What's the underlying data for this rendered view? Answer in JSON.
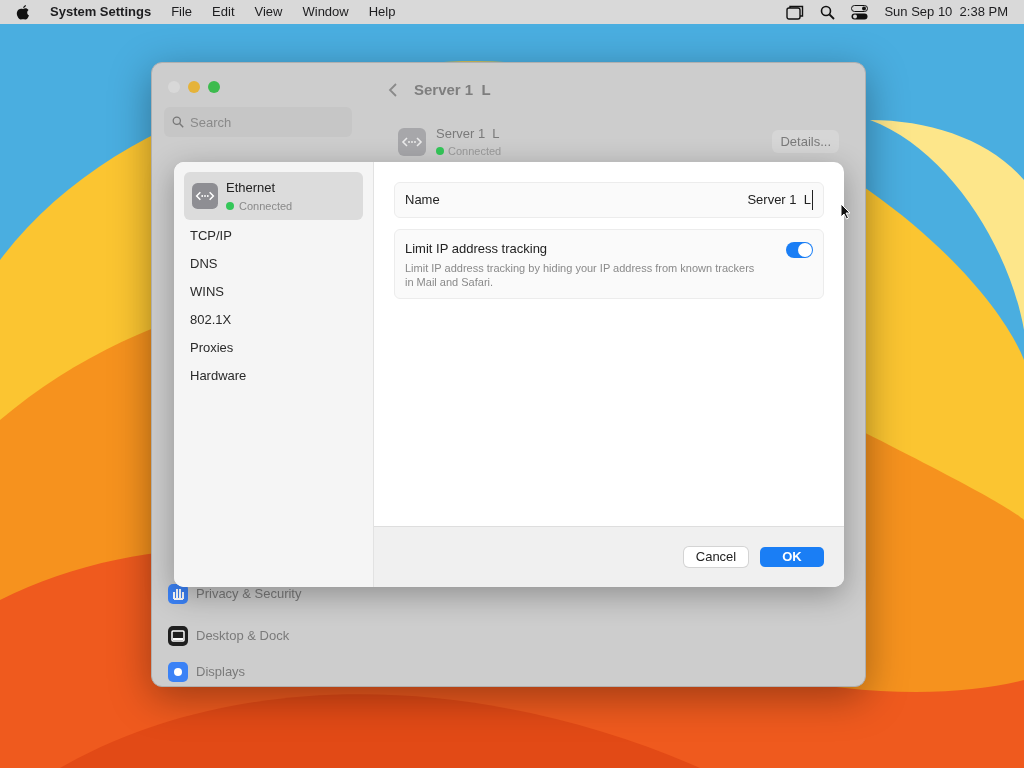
{
  "menu_bar": {
    "app": "System Settings",
    "menus": [
      "File",
      "Edit",
      "View",
      "Window",
      "Help"
    ],
    "clock": "Sun Sep 10  2:38 PM"
  },
  "window": {
    "title": "Server 1  L",
    "search": {
      "placeholder": "Search"
    },
    "service": {
      "name": "Server 1  L",
      "status": "Connected",
      "details_button": "Details..."
    },
    "sidebar_items": [
      {
        "label": "Privacy & Security",
        "kind": "privacy"
      },
      {
        "label": "Desktop & Dock",
        "kind": "desktop"
      },
      {
        "label": "Displays",
        "kind": "displays"
      }
    ]
  },
  "sheet": {
    "header": {
      "name": "Ethernet",
      "status": "Connected",
      "selected": true
    },
    "nav_items": [
      {
        "label": "TCP/IP",
        "selected": false
      },
      {
        "label": "DNS",
        "selected": false
      },
      {
        "label": "WINS",
        "selected": false
      },
      {
        "label": "802.1X",
        "selected": false
      },
      {
        "label": "Proxies",
        "selected": false
      },
      {
        "label": "Hardware",
        "selected": false
      }
    ],
    "name_row": {
      "label": "Name",
      "value": "Server 1  L"
    },
    "tracking": {
      "title": "Limit IP address tracking",
      "description": "Limit IP address tracking by hiding your IP address from known trackers in Mail and Safari.",
      "on": true
    },
    "buttons": [
      {
        "label": "Cancel",
        "kind": "secondary"
      },
      {
        "label": "OK",
        "kind": "primary"
      }
    ]
  }
}
